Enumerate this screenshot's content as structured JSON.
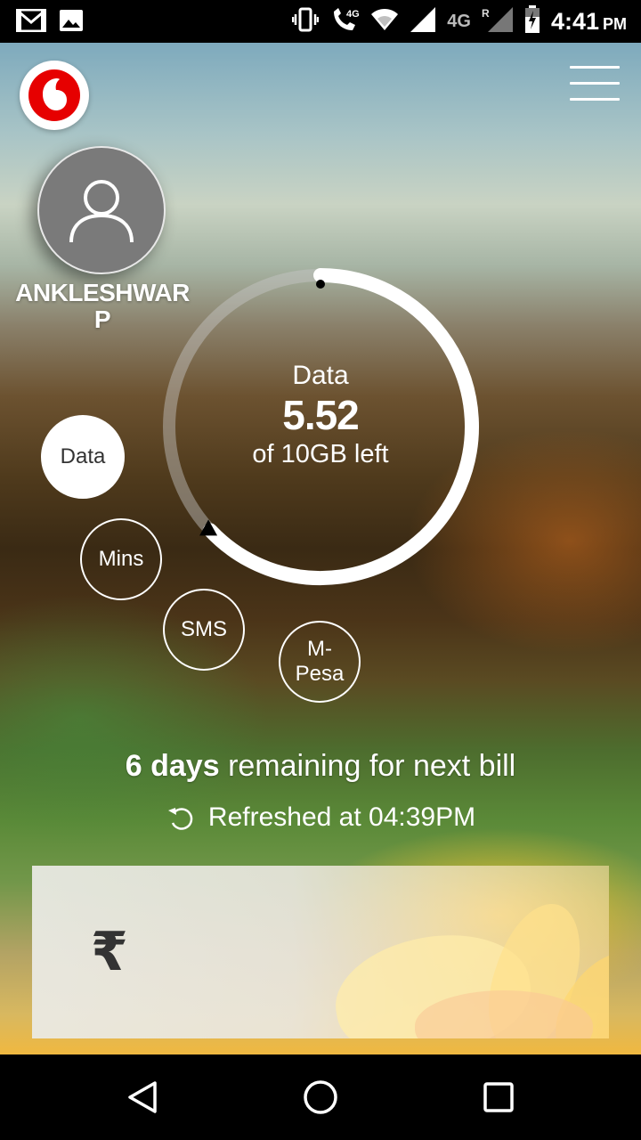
{
  "status_bar": {
    "time": "4:41",
    "ampm": "PM",
    "network_1": "4G",
    "network_2": "4G",
    "roaming": "R"
  },
  "profile": {
    "name": "ANKLESHWAR P"
  },
  "usage": {
    "label": "Data",
    "value": "5.52",
    "subtitle": "of 10GB left",
    "remaining_fraction": 0.552
  },
  "tabs": [
    {
      "label": "Data",
      "active": true
    },
    {
      "label": "Mins",
      "active": false
    },
    {
      "label": "SMS",
      "active": false
    },
    {
      "label": "M-Pesa",
      "active": false
    }
  ],
  "bill": {
    "days": "6 days",
    "text": "remaining for next bill"
  },
  "refresh": {
    "text": "Refreshed at 04:39PM"
  },
  "card": {
    "currency_symbol": "₹"
  },
  "icons": {
    "logo": "vodafone-logo",
    "menu": "hamburger-menu-icon",
    "avatar": "user-icon",
    "refresh": "refresh-icon",
    "nav": [
      "back-icon",
      "home-icon",
      "recents-icon"
    ]
  },
  "colors": {
    "brand_red": "#e60000",
    "active_tab_bg": "#ffffff"
  }
}
